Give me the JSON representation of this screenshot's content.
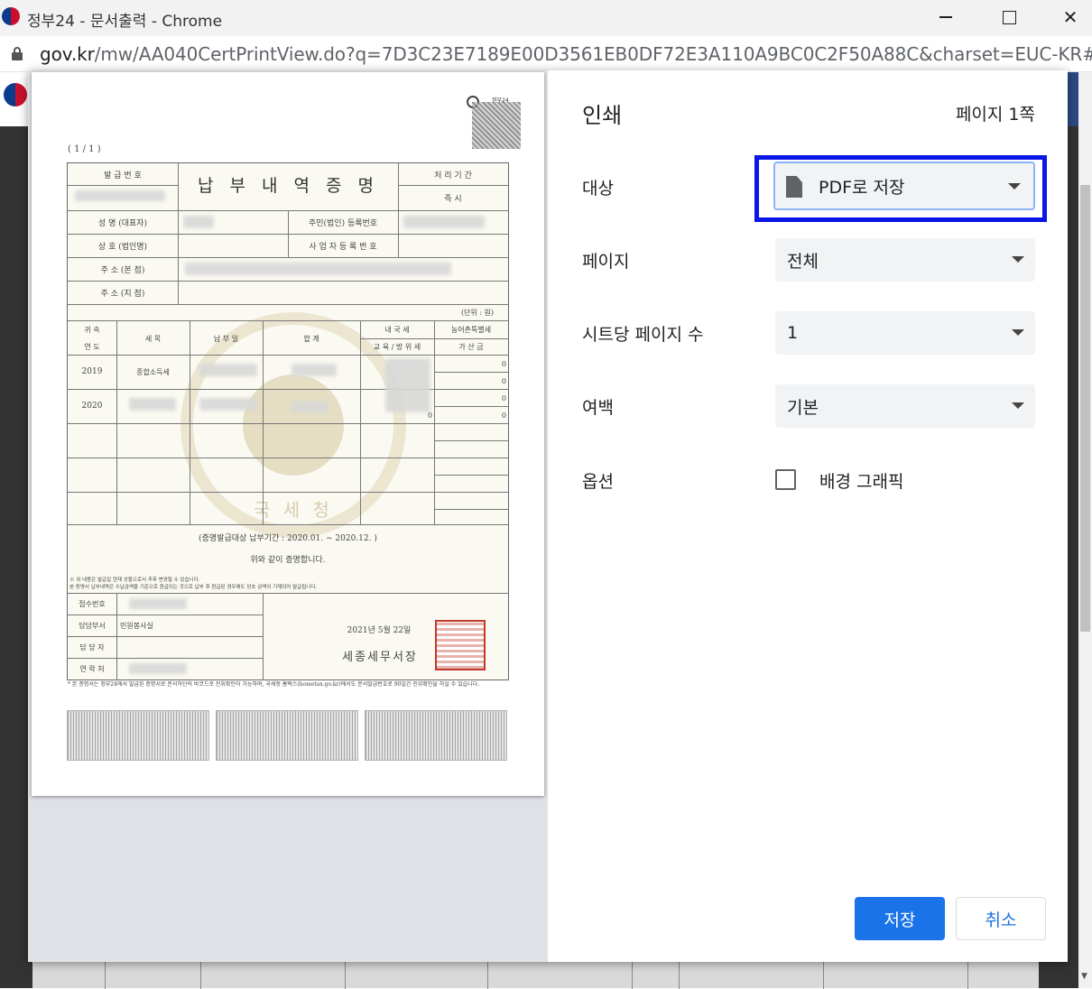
{
  "window": {
    "title": "정부24 - 문서출력 - Chrome",
    "url_host": "gov.kr",
    "url_path": "/mw/AA040CertPrintView.do?q=7D3C23E7189E00D3561EB0DF72E3A110A9BC0C2F50A88C&charset=EUC-KR#"
  },
  "print": {
    "title": "인쇄",
    "page_count": "페이지 1쪽",
    "destination_label": "대상",
    "destination_value": "PDF로 저장",
    "pages_label": "페이지",
    "pages_value": "전체",
    "pages_per_sheet_label": "시트당 페이지 수",
    "pages_per_sheet_value": "1",
    "margins_label": "여백",
    "margins_value": "기본",
    "options_label": "옵션",
    "background_graphics_label": "배경 그래픽",
    "background_graphics_checked": false,
    "save_button": "저장",
    "cancel_button": "취소"
  },
  "certificate": {
    "page_indicator": "( 1 / 1 )",
    "qr_label": "정부24",
    "title": "납 부 내 역 증 명",
    "issue_no_label": "발 급 번 호",
    "processing_label": "처 리 기 간",
    "processing_value": "즉        시",
    "name_label": "성 명 (대표자)",
    "resident_no_label": "주민(법인) 등록번호",
    "company_label": "상 호 (법인명)",
    "business_no_label": "사 업 자 등 록 번 호",
    "address_label": "주 소 (본   점)",
    "address2_label": "주 소 (지   점)",
    "unit": "(단위 : 원)",
    "col_year_1": "귀  속",
    "col_year_2": "연  도",
    "col_tax_item": "세        목",
    "col_pay_date": "납 부 일",
    "col_total": "합        계",
    "col_national_1": "내  국  세",
    "col_national_2": "교 육 / 방 위 세",
    "col_rural_1": "농어촌특별세",
    "col_rural_2": "가   산   금",
    "rows": [
      {
        "year": "2019",
        "item": "종합소득세"
      },
      {
        "year": "2020",
        "item": ""
      }
    ],
    "zeros": [
      "0",
      "0",
      "0",
      "0",
      "0"
    ],
    "period": "(증명발급대상 납부기간 : 2020.01. ~ 2020.12. )",
    "certify": "위와 같이 증명합니다.",
    "note1": "※ 위 내용은 발급일 현재 상황으로서 추후 변경될 수 있습니다.",
    "note2": "   본 증명서 납부내역은 수납금액을 기준으로 환급되는 것으로 납부 후 환급된 경우에도 당초 금액이 기재되어 발급됩니다.",
    "receipt_no_label": "접수번호",
    "dept_label": "담당부서",
    "dept_value": "민원봉사실",
    "staff_label": "담 당 자",
    "contact_label": "연 락 처",
    "date": "2021년 5월 22일",
    "issuer": "세종세무서장",
    "footnote": "* 본 증명서는 정부24에서 발급된 증명서로 문서하단의 바코드로 진위확인이 가능하며, 국세청 홈택스(hometax.go.kr)에서도 문서발급번호로 90일간 진위확인을 하실 수 있습니다.",
    "watermark": "국 세 청"
  }
}
